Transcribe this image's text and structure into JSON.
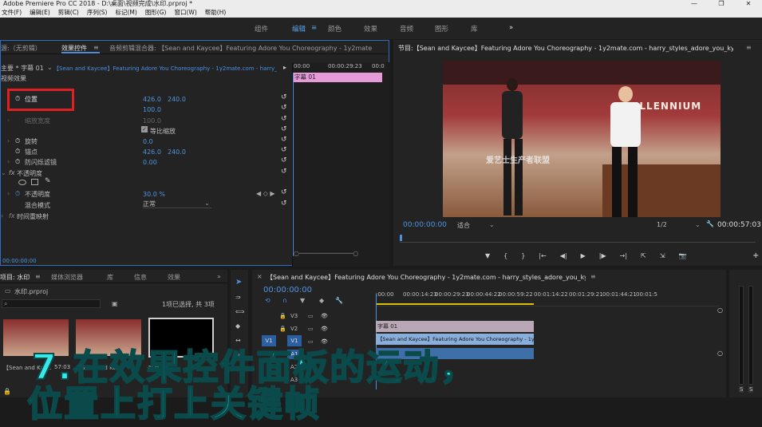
{
  "window": {
    "title": "Adobe Premiere Pro CC 2018 - D:\\桌面\\视频完成\\水印.prproj *",
    "controls": [
      "—",
      "❐",
      "✕"
    ]
  },
  "menu": [
    "文件(F)",
    "编辑(E)",
    "剪辑(C)",
    "序列(S)",
    "标记(M)",
    "图形(G)",
    "窗口(W)",
    "帮助(H)"
  ],
  "workspace": {
    "items": [
      "组件",
      "编辑",
      "颜色",
      "效果",
      "音频",
      "图形",
      "库"
    ],
    "active_menu_glyph": "≡",
    "more_glyph": "»"
  },
  "effect_controls": {
    "tabs": [
      "源:（无剪辑）",
      "效果控件",
      "音频剪辑混合器: 【Sean and Kaycee】Featuring Adore You Choreography - 1y2mate.com - harry_sty"
    ],
    "menu_glyph": "≡",
    "clip_selector": "主要 * 字幕 01",
    "clip_link": "【Sean and Kaycee】Featuring Adore You Choreography - 1y2mate.com - harry_style...",
    "mini_time_start": "00:00",
    "mini_time_mid": "00:00:29:23",
    "mini_time_end": "00:0",
    "mini_clip_label": "字幕 01",
    "section_video": "视频效果",
    "fx_label": "fx",
    "rows": {
      "position": {
        "label": "位置",
        "x": "426.0",
        "y": "240.0"
      },
      "scale": {
        "value": "100.0"
      },
      "scale_width": {
        "label": "缩放宽度",
        "value": "100.0"
      },
      "uniform_scale": {
        "label": "等比缩放"
      },
      "rotation": {
        "label": "旋转",
        "value": "0.0"
      },
      "anchor": {
        "label": "锚点",
        "x": "426.0",
        "y": "240.0"
      },
      "anti_flicker": {
        "label": "防闪烁滤镜",
        "value": "0.00"
      },
      "opacity_section": {
        "label": "不透明度"
      },
      "opacity": {
        "label": "不透明度",
        "value": "30.0 %"
      },
      "blend_mode": {
        "label": "混合模式",
        "value": "正常"
      },
      "time_remap": {
        "label": "时间重映射"
      }
    },
    "timecode": "00:00:00:00"
  },
  "program_monitor": {
    "title": "节目:【Sean and Kaycee】Featuring Adore You Choreography - 1y2mate.com - harry_styles_adore_you_ky(Av87486750,P1)",
    "menu_glyph": "≡",
    "video_overlay_text": "爱艺士生产者联盟",
    "wall_text": "MILLENNIUM",
    "timecode_current": "00:00:00:00",
    "fit": "适合",
    "resolution": "1/2",
    "timecode_total": "00:00:57:03",
    "controls": [
      "▼",
      "{",
      "}",
      "|←",
      "◀|",
      "▶",
      "|▶",
      "→|",
      "⇱",
      "⇲",
      "📷"
    ],
    "add_glyph": "+"
  },
  "project": {
    "tabs": [
      "项目: 水印",
      "媒体浏览器",
      "库",
      "信息",
      "效果"
    ],
    "menu_glyph": "≡",
    "more_glyph": "»",
    "file": "水印.prproj",
    "selection_info": "1项已选择, 共 3项",
    "thumb_captions": [
      "【Sean and Kay...",
      "【Sean and Kay...",
      "字幕 01"
    ],
    "thumb_duration": "57:03"
  },
  "timeline": {
    "title": "【Sean and Kaycee】Featuring Adore You Choreography - 1y2mate.com - harry_styles_adore_you_ky(Av87486750,P1)",
    "menu_glyph": "≡",
    "close_glyph": "×",
    "timecode": "00:00:00:00",
    "ruler": [
      ":00:00",
      "00:00:14:23",
      "00:00:29:23",
      "00:00:44:22",
      "00:00:59:22",
      "00:01:14:22",
      "00:01:29:21",
      "00:01:44:21",
      "00:01:5"
    ],
    "tracks": [
      "V3",
      "V2",
      "V1",
      "A1",
      "A2",
      "A3"
    ],
    "source_patch": "V1",
    "clip_v2": "字幕 01",
    "clip_v1": "【Sean and Kaycee】Featuring Adore You Choreography - 1y2mate"
  },
  "audio_meter": {
    "labels": [
      "S",
      "S"
    ]
  },
  "caption": {
    "line1": "7.在效果控件面板的运动，",
    "line2": "位置上打上关键帧"
  },
  "colors": {
    "accent_blue": "#4c8fe0",
    "caption_cyan": "#38e8e8",
    "clip_pink": "#e69ad8",
    "highlight_red": "#e02020"
  }
}
